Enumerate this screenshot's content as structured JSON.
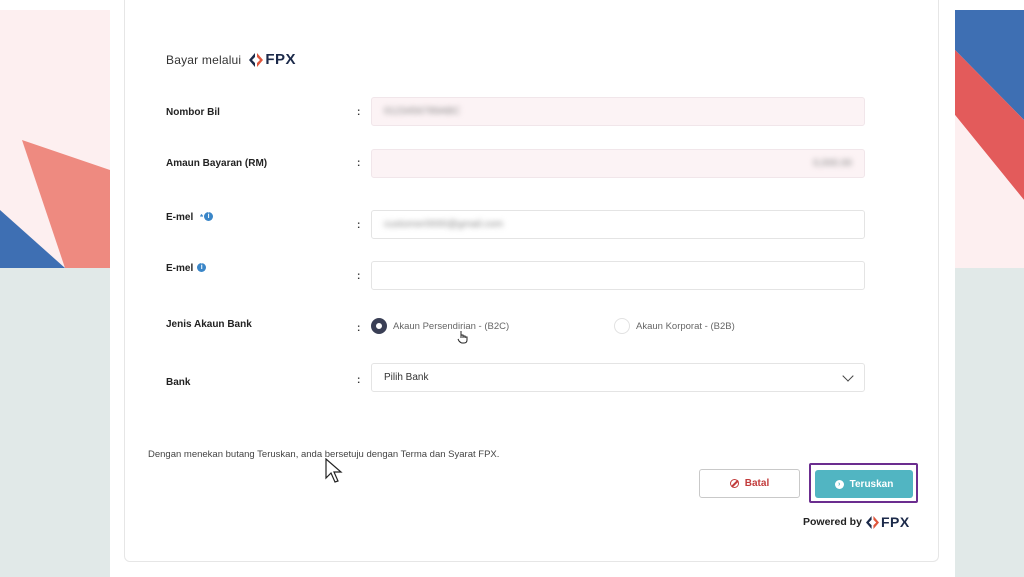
{
  "header": {
    "prefix": "Bayar melalui",
    "brand": "FPX"
  },
  "form": {
    "bill_number": {
      "label": "Nombor Bil",
      "value": "0123456789ABC"
    },
    "amount": {
      "label": "Amaun Bayaran (RM)",
      "value": "0,000.00"
    },
    "email": {
      "label": "E-mel",
      "value": "customer0000@gmail.com",
      "required_mark": "*"
    },
    "email_confirm": {
      "label": "E-mel",
      "value": ""
    },
    "account_type": {
      "label": "Jenis Akaun Bank",
      "options": [
        {
          "label": "Akaun Persendirian - (B2C)",
          "selected": true
        },
        {
          "label": "Akaun Korporat - (B2B)",
          "selected": false
        }
      ]
    },
    "bank": {
      "label": "Bank",
      "selected": "Pilih Bank"
    },
    "colon": ":"
  },
  "terms_text": "Dengan menekan butang Teruskan, anda bersetuju dengan Terma dan Syarat FPX.",
  "buttons": {
    "cancel": "Batal",
    "next": "Teruskan"
  },
  "footer": {
    "powered_by": "Powered by",
    "brand": "FPX"
  },
  "colors": {
    "accent": "#51b5c2",
    "highlight": "#6b2d8f",
    "danger": "#c23b3b"
  }
}
